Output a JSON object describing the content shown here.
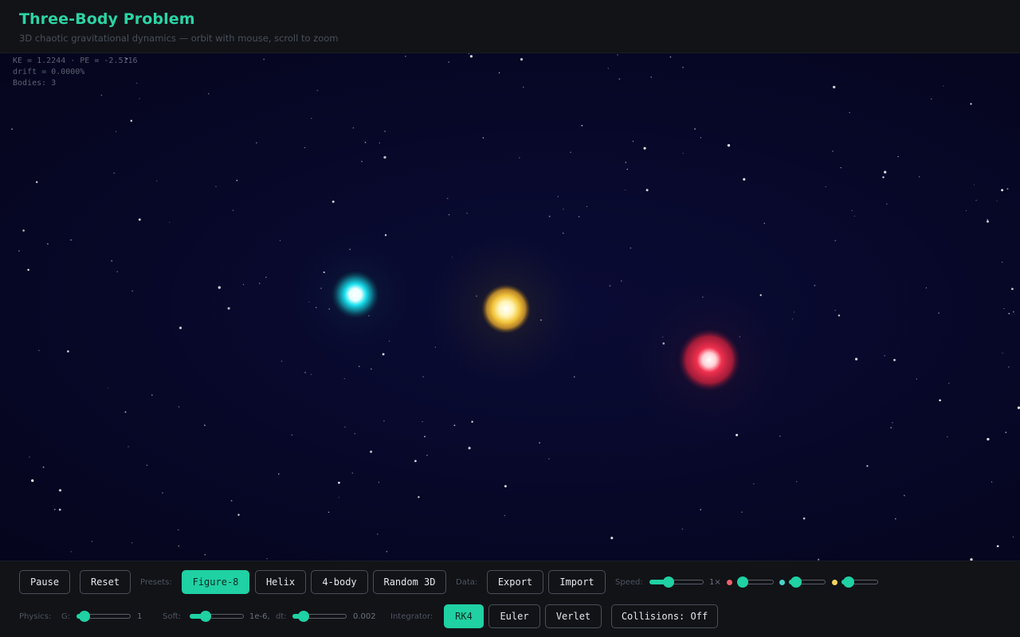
{
  "header": {
    "title": "Three-Body Problem",
    "subtitle": "3D chaotic gravitational dynamics — orbit with mouse, scroll to zoom"
  },
  "hud": {
    "energy": "KE = 1.2244 · PE = -2.5116",
    "drift": "drift = 0.0000%",
    "bodies": "Bodies: 3"
  },
  "bodies": [
    {
      "name": "cyan-body",
      "color": "#19e0ee"
    },
    {
      "name": "yellow-body",
      "color": "#f3c53a"
    },
    {
      "name": "red-body",
      "color": "#f0304e"
    }
  ],
  "controls": {
    "pause": "Pause",
    "reset": "Reset",
    "presets_label": "Presets:",
    "presets": [
      "Figure-8",
      "Helix",
      "4-body",
      "Random 3D"
    ],
    "active_preset": "Figure-8",
    "data_label": "Data:",
    "export": "Export",
    "import": "Import",
    "speed_label": "Speed:",
    "speed_value": "1×",
    "speed_level": 0.35,
    "mass_sliders": [
      {
        "color": "#f0606a",
        "level": 0.15
      },
      {
        "color": "#4cd3c9",
        "level": 0.2
      },
      {
        "color": "#f5d45a",
        "level": 0.2
      }
    ],
    "physics_label": "Physics:",
    "g_label": "G:",
    "g_value": "1",
    "g_level": 0.15,
    "soft_label": "Soft:",
    "soft_value": "1e-6,",
    "soft_level": 0.3,
    "dt_label": "dt:",
    "dt_value": "0.002",
    "dt_level": 0.2,
    "integrator_label": "Integrator:",
    "integrators": [
      "RK4",
      "Euler",
      "Verlet"
    ],
    "active_integrator": "RK4",
    "collisions": "Collisions: Off"
  },
  "colors": {
    "accent": "#1fd1a3",
    "title": "#2bd4a4"
  }
}
